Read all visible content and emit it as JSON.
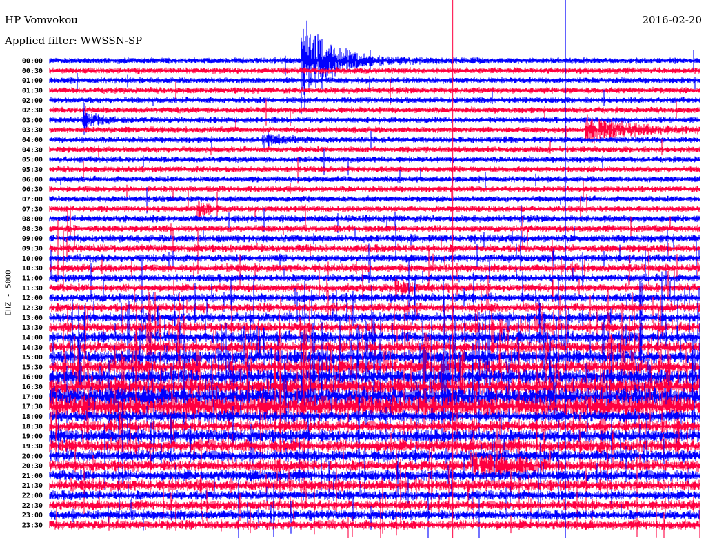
{
  "header": {
    "station": "HP Vomvokou",
    "filter": "Applied filter: WWSSN-SP",
    "date": "2016-02-20"
  },
  "chart_data": {
    "type": "line",
    "title": "HP Vomvokou",
    "subtitle": "Applied filter: WWSSN-SP",
    "ylabel": "EHZ - 5000",
    "xlabel": "",
    "row_minutes": 30,
    "colors": [
      "#0000ff",
      "#ff0040"
    ],
    "rows": [
      "00:00",
      "00:30",
      "01:00",
      "01:30",
      "02:00",
      "02:30",
      "03:00",
      "03:30",
      "04:00",
      "04:30",
      "05:00",
      "05:30",
      "06:00",
      "06:30",
      "07:00",
      "07:30",
      "08:00",
      "08:30",
      "09:00",
      "09:30",
      "10:00",
      "10:30",
      "11:00",
      "11:30",
      "12:00",
      "12:30",
      "13:00",
      "13:30",
      "14:00",
      "14:30",
      "15:00",
      "15:30",
      "16:00",
      "16:30",
      "17:00",
      "17:30",
      "18:00",
      "18:30",
      "19:00",
      "19:30",
      "20:00",
      "20:30",
      "21:00",
      "21:30",
      "22:00",
      "22:30",
      "23:00",
      "23:30"
    ],
    "noise_level": [
      3,
      3,
      3,
      3,
      3,
      3,
      3,
      3,
      3,
      3,
      3,
      3,
      3,
      3,
      3,
      3,
      3.5,
      3.5,
      4,
      4,
      4,
      4,
      4,
      4,
      4.5,
      4.5,
      5,
      5,
      6,
      6,
      7,
      7,
      8,
      9,
      11,
      12,
      6,
      6,
      7,
      7,
      6,
      6,
      6,
      6,
      5,
      5,
      5,
      5
    ],
    "spike_rate": [
      0.003,
      0.003,
      0.003,
      0.003,
      0.003,
      0.003,
      0.003,
      0.003,
      0.003,
      0.003,
      0.003,
      0.003,
      0.004,
      0.005,
      0.006,
      0.007,
      0.008,
      0.009,
      0.01,
      0.012,
      0.014,
      0.016,
      0.018,
      0.02,
      0.025,
      0.03,
      0.035,
      0.04,
      0.05,
      0.05,
      0.06,
      0.06,
      0.06,
      0.06,
      0.05,
      0.04,
      0.02,
      0.02,
      0.02,
      0.02,
      0.02,
      0.02,
      0.02,
      0.02,
      0.02,
      0.02,
      0.02,
      0.02
    ],
    "events": [
      {
        "row": "00:00",
        "minute": 11.6,
        "amplitude": 90,
        "decay_minutes": 1.2
      },
      {
        "row": "03:00",
        "minute": 1.5,
        "amplitude": 25,
        "decay_minutes": 0.5
      },
      {
        "row": "03:30",
        "minute": 24.7,
        "amplitude": 22,
        "decay_minutes": 2.0
      },
      {
        "row": "04:00",
        "minute": 9.8,
        "amplitude": 12,
        "decay_minutes": 0.8
      },
      {
        "row": "07:30",
        "minute": 6.8,
        "amplitude": 18,
        "decay_minutes": 0.4
      },
      {
        "row": "11:30",
        "minute": 16.0,
        "amplitude": 14,
        "decay_minutes": 0.6
      },
      {
        "row": "20:30",
        "minute": 19.4,
        "amplitude": 30,
        "decay_minutes": 1.5
      }
    ],
    "vertical_marks": [
      {
        "minute": 18.6,
        "color": "#ff0040"
      },
      {
        "minute": 23.8,
        "color": "#0000ff"
      }
    ]
  }
}
